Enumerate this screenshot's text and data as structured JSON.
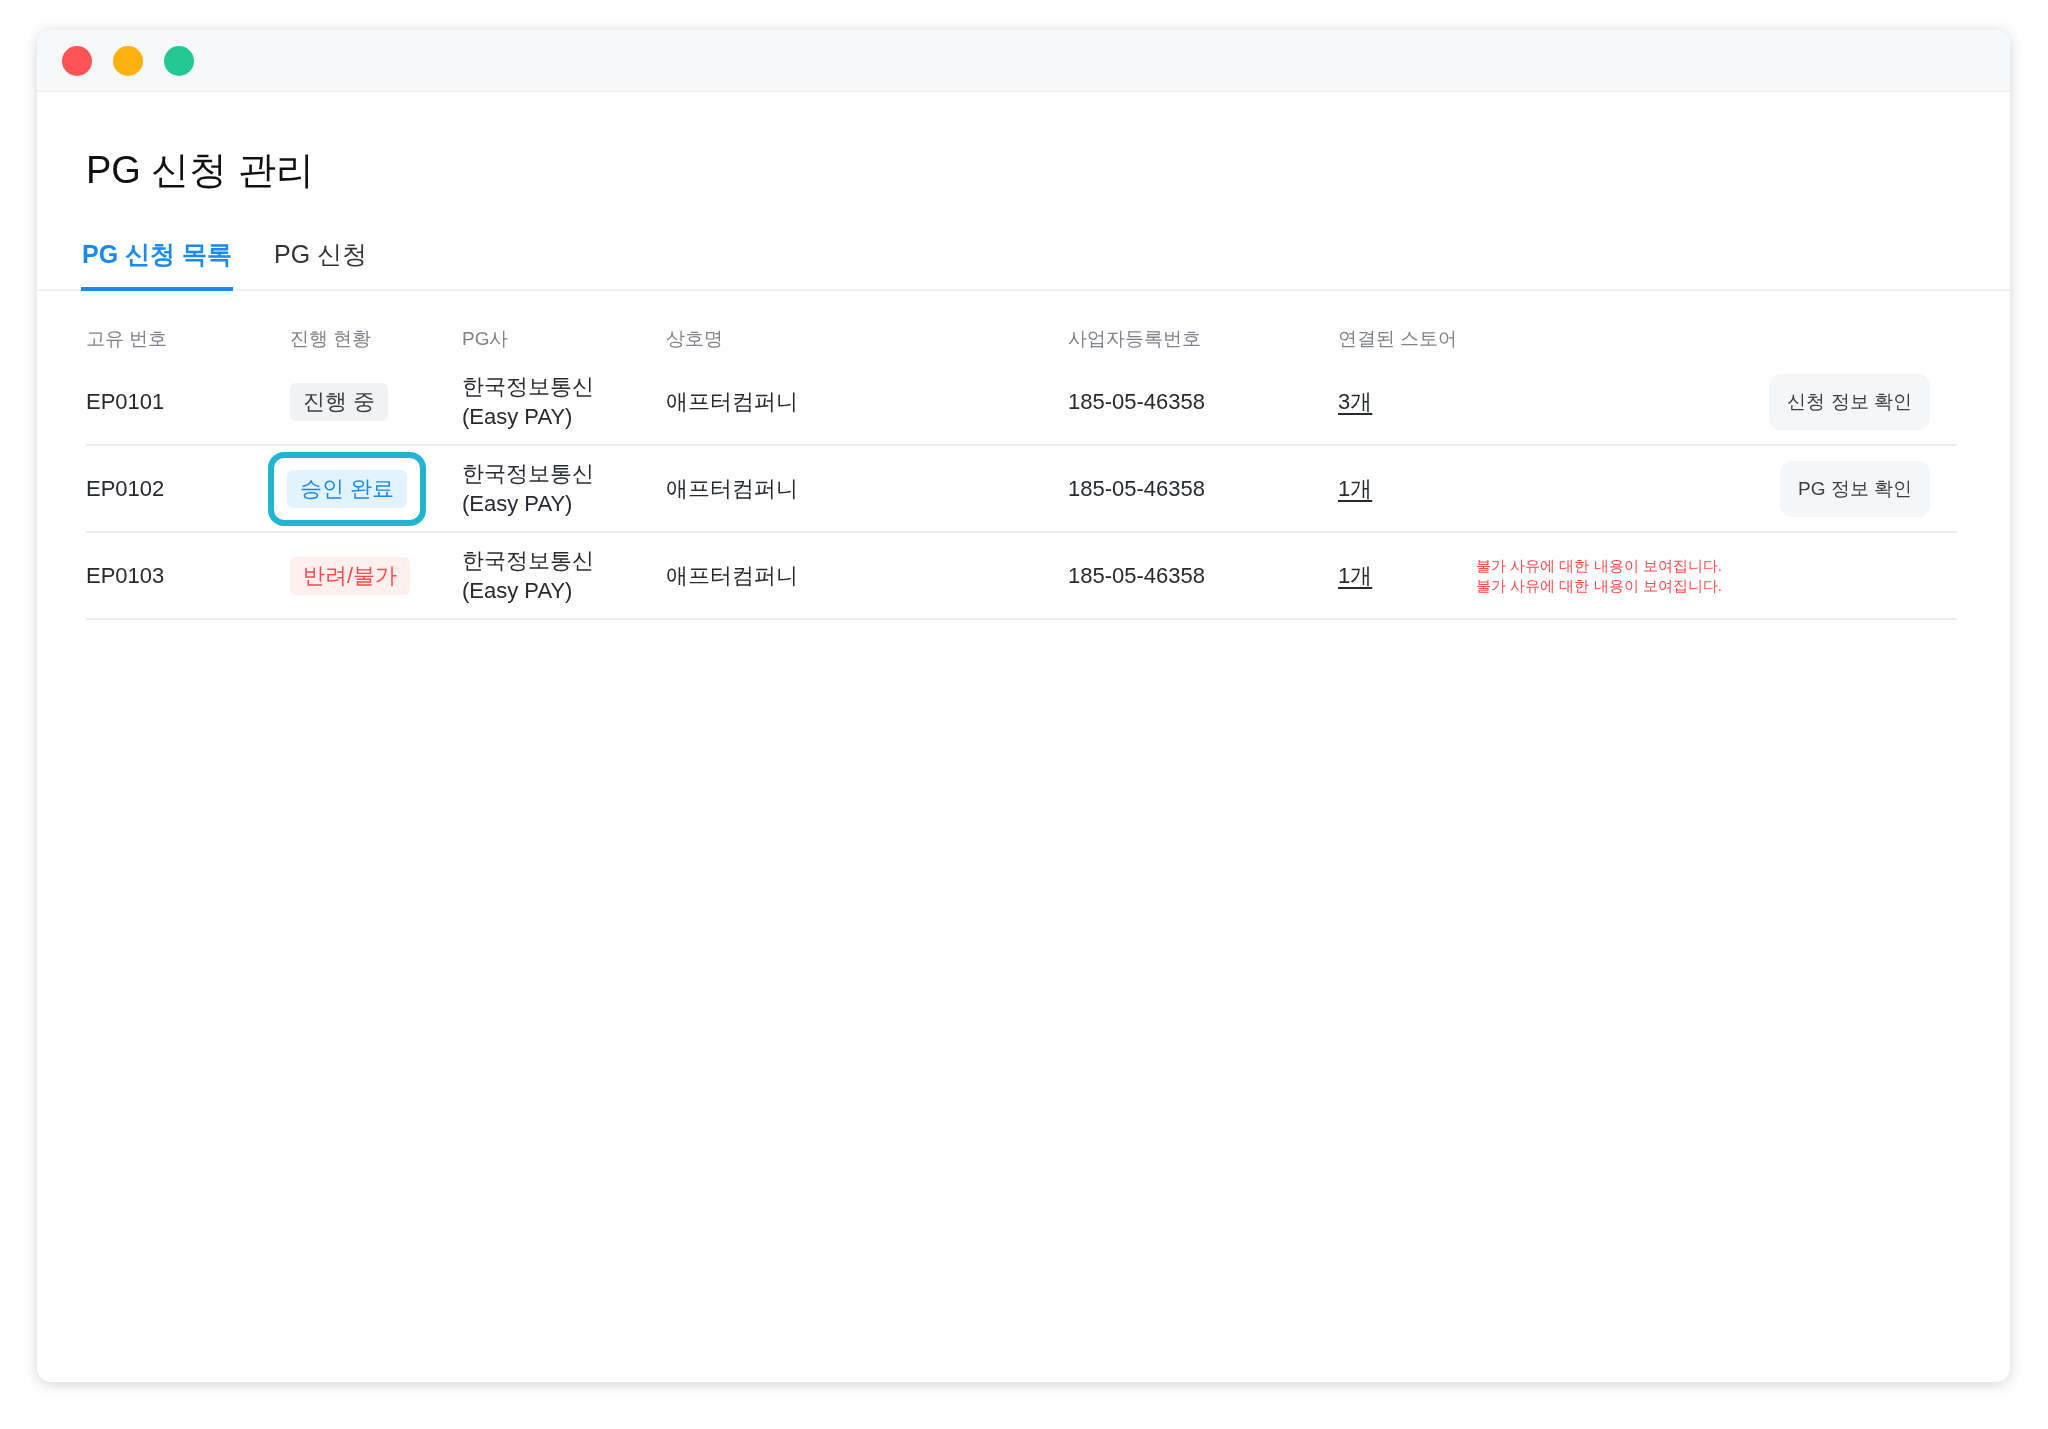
{
  "window": {
    "controls": [
      {
        "color": "#fe5453"
      },
      {
        "color": "#fdb10d"
      },
      {
        "color": "#22c994"
      }
    ]
  },
  "page_title": "PG 신청 관리",
  "tabs": [
    {
      "label": "PG 신청 목록",
      "selected": true
    },
    {
      "label": "PG 신청",
      "selected": false
    }
  ],
  "table": {
    "columns": [
      "고유 번호",
      "진행 현황",
      "PG사",
      "상호명",
      "사업자등록번호",
      "연결된 스토어"
    ],
    "rows": [
      {
        "id": "EP0101",
        "status": {
          "label": "진행 중",
          "kind": "progress",
          "highlighted": false
        },
        "pg_lines": [
          "한국정보통신",
          "(Easy PAY)"
        ],
        "company": "애프터컴퍼니",
        "business_number": "185-05-46358",
        "stores": "3개",
        "button": "신청 정보 확인"
      },
      {
        "id": "EP0102",
        "status": {
          "label": "승인 완료",
          "kind": "approved",
          "highlighted": true
        },
        "pg_lines": [
          "한국정보통신",
          "(Easy PAY)"
        ],
        "company": "애프터컴퍼니",
        "business_number": "185-05-46358",
        "stores": "1개",
        "button": "PG 정보 확인"
      },
      {
        "id": "EP0103",
        "status": {
          "label": "반려/불가",
          "kind": "rejected",
          "highlighted": false
        },
        "pg_lines": [
          "한국정보통신",
          "(Easy PAY)"
        ],
        "company": "애프터컴퍼니",
        "business_number": "185-05-46358",
        "stores": "1개",
        "reason_lines": [
          "불가 사유에 대한 내용이 보여집니다.",
          "불가 사유에 대한 내용이 보여집니다."
        ]
      }
    ]
  }
}
